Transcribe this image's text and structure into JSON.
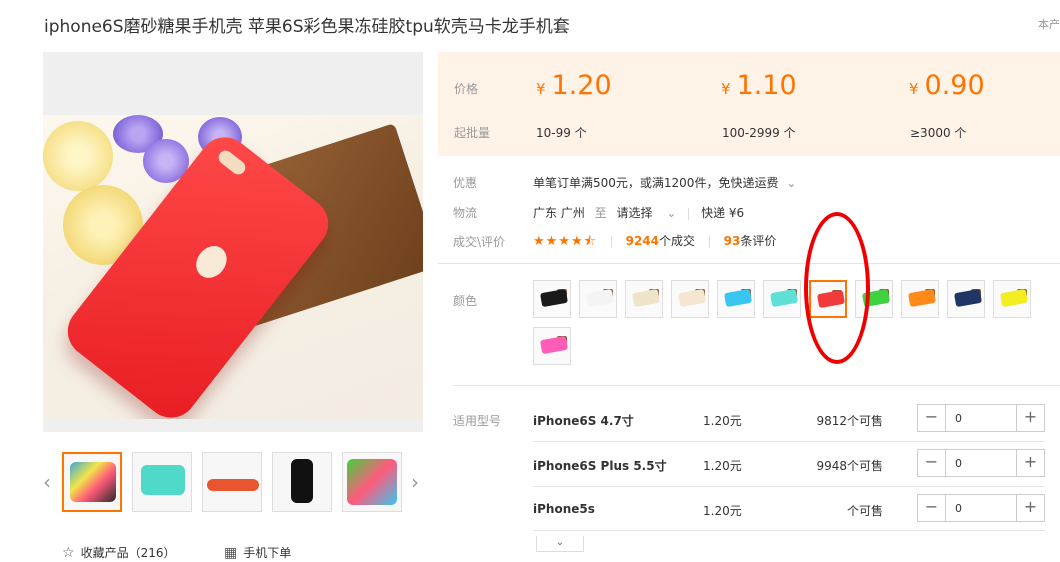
{
  "product": {
    "title": "iphone6S磨砂糖果手机壳 苹果6S彩色果冻硅胶tpu软壳马卡龙手机套",
    "corner_text": "本产"
  },
  "price_panel": {
    "price_label": "价格",
    "moq_label": "起批量",
    "tiers": [
      {
        "currency": "¥",
        "price": "1.20",
        "range": "10-99 个"
      },
      {
        "currency": "¥",
        "price": "1.10",
        "range": "100-2999 个"
      },
      {
        "currency": "¥",
        "price": "0.90",
        "range": "≥3000 个"
      }
    ]
  },
  "info": {
    "discount_label": "优惠",
    "discount_text": "单笔订单满500元，或满1200件，免快递运费",
    "logistics_label": "物流",
    "origin": "广东 广州",
    "to": "至",
    "destination": "请选择",
    "express": "快递 ¥6",
    "deals_label": "成交\\评价",
    "rating_stars": 4.5,
    "deals_count": "9244",
    "deals_suffix": "个成交",
    "reviews_count": "93",
    "reviews_suffix": "条评价"
  },
  "colors": {
    "label": "颜色",
    "selected_index": 6,
    "swatches": [
      {
        "name": "black",
        "color": "#1a1a1a"
      },
      {
        "name": "white",
        "color": "#f4f4f4"
      },
      {
        "name": "beige",
        "color": "#efe3c8"
      },
      {
        "name": "cream",
        "color": "#f5e6d0"
      },
      {
        "name": "sky-blue",
        "color": "#38c6f0"
      },
      {
        "name": "mint",
        "color": "#5fe0d6"
      },
      {
        "name": "red",
        "color": "#f23a3a"
      },
      {
        "name": "green",
        "color": "#3fd23f"
      },
      {
        "name": "orange",
        "color": "#ff8a1a"
      },
      {
        "name": "navy",
        "color": "#1f3566"
      },
      {
        "name": "yellow",
        "color": "#f2ee22"
      },
      {
        "name": "pink",
        "color": "#ff5cb8"
      }
    ]
  },
  "models": {
    "label": "适用型号",
    "rows": [
      {
        "name": "iPhone6S 4.7寸",
        "price": "1.20元",
        "stock": "9812个可售",
        "qty": "0"
      },
      {
        "name": "iPhone6S Plus 5.5寸",
        "price": "1.20元",
        "stock": "9948个可售",
        "qty": "0"
      },
      {
        "name": "iPhone5s",
        "price": "1.20元",
        "stock": "个可售",
        "qty": "0"
      }
    ]
  },
  "bottom": {
    "favorite": "收藏产品（216）",
    "mobile_order": "手机下单"
  },
  "thumbnails": [
    {
      "name": "thumb-collage",
      "color": "#3aa7d8"
    },
    {
      "name": "thumb-mint",
      "color": "#4fd9c9"
    },
    {
      "name": "thumb-red-side",
      "color": "#e8552f"
    },
    {
      "name": "thumb-black",
      "color": "#111111"
    },
    {
      "name": "thumb-multicolor",
      "color": "#ff5a7a"
    }
  ]
}
